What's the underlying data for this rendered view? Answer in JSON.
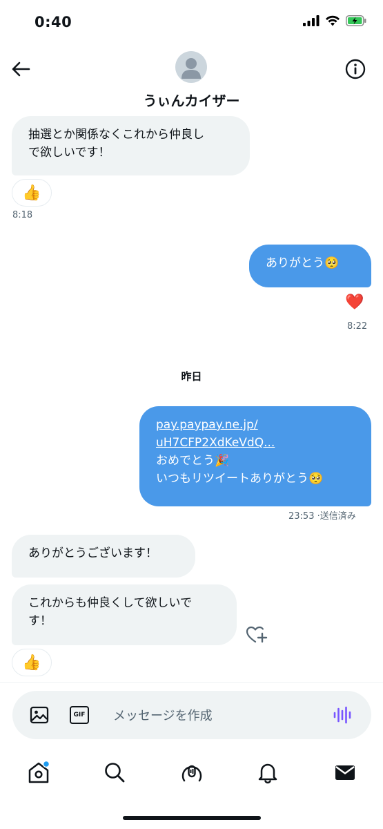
{
  "status_bar": {
    "time": "0:40"
  },
  "header": {
    "contact_name": "うぃんカイザー",
    "icons": {
      "back": "arrow-left-icon",
      "info": "info-icon",
      "avatar": "default-avatar"
    }
  },
  "messages": [
    {
      "direction": "in",
      "lines": [
        "抽選とか関係なくこれから仲良し",
        "で欲しいです！"
      ],
      "reaction": "👍",
      "time": "8:18"
    },
    {
      "direction": "out",
      "lines": [
        "ありがとう🥺"
      ],
      "reaction": "❤️",
      "time": "8:22"
    },
    {
      "direction": "out",
      "link_lines": [
        "pay.paypay.ne.jp/",
        "uH7CFP2XdKeVdQ..."
      ],
      "lines": [
        "おめでとう🎉",
        "いつもリツイートありがとう🥺"
      ],
      "time": "23:53",
      "status": "·送信済み"
    },
    {
      "direction": "in",
      "lines": [
        "ありがとうございます！"
      ]
    },
    {
      "direction": "in",
      "lines": [
        "これからも仲良くして欲しいで",
        "す！"
      ],
      "reaction": "👍",
      "action_icon": "heart-plus-icon"
    }
  ],
  "date_separator": "昨日",
  "composer": {
    "placeholder": "メッセージを作成",
    "gif_label": "GIF"
  },
  "nav": [
    "home-icon",
    "search-icon",
    "spaces-icon",
    "notifications-icon",
    "messages-icon"
  ],
  "colors": {
    "accent": "#4a99e9",
    "incoming_bubble": "#eff3f4",
    "voice_icon": "#7856ff",
    "notification_dot": "#1d9bf0"
  }
}
